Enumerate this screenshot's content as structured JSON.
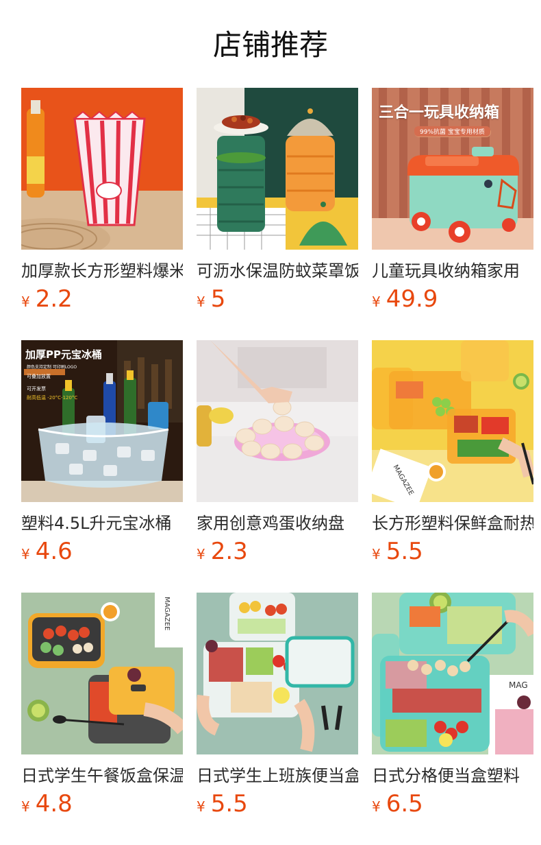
{
  "header": {
    "title": "店铺推荐"
  },
  "currency": "¥",
  "products": [
    {
      "name": "加厚款长方形塑料爆米花桶",
      "price": "2.2",
      "image_icon": "popcorn-bucket-image"
    },
    {
      "name": "可沥水保温防蚊菜罩饭菜罩",
      "price": "5",
      "image_icon": "food-cover-image"
    },
    {
      "name": "儿童玩具收纳箱家用",
      "price": "49.9",
      "image_icon": "toy-storage-box-image",
      "banner": {
        "title": "三合一玩具收纳箱",
        "subtitle": "99%抗菌 宝宝专用材质"
      }
    },
    {
      "name": "塑料4.5L升元宝冰桶",
      "price": "4.6",
      "image_icon": "ice-bucket-image",
      "banner": {
        "title": "加厚PP元宝冰桶",
        "line1": "颜色支持定制 可印刷LOGO",
        "line2": "可叠加放置",
        "line3": "可开发票",
        "line4": "耐高低温 -20°C-120°C"
      }
    },
    {
      "name": "家用创意鸡蛋收纳盘",
      "price": "2.3",
      "image_icon": "egg-tray-image"
    },
    {
      "name": "长方形塑料保鲜盒耐热",
      "price": "5.5",
      "image_icon": "crisper-box-image",
      "magazine": "MAGAZEE"
    },
    {
      "name": "日式学生午餐饭盒保温",
      "price": "4.8",
      "image_icon": "lunch-box-image",
      "magazine": "MAGAZEE"
    },
    {
      "name": "日式学生上班族便当盒",
      "price": "5.5",
      "image_icon": "bento-box-image"
    },
    {
      "name": "日式分格便当盒塑料",
      "price": "6.5",
      "image_icon": "divided-bento-image",
      "magazine": "MAG"
    }
  ],
  "colors": {
    "price": "#e8480e",
    "title": "#111111",
    "name": "#2a2a2a"
  }
}
